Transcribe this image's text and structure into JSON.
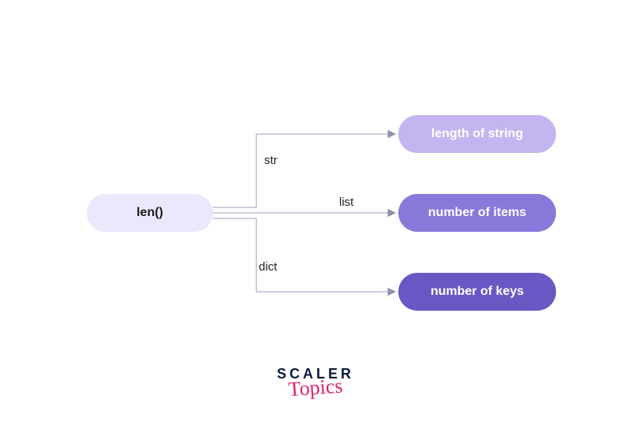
{
  "diagram": {
    "source": {
      "label": "len()"
    },
    "branches": [
      {
        "type_label": "str",
        "output_label": "length of string"
      },
      {
        "type_label": "list",
        "output_label": "number of items"
      },
      {
        "type_label": "dict",
        "output_label": "number of keys"
      }
    ]
  },
  "footer": {
    "brand_upper": "SCALER",
    "brand_lower": "Topics"
  },
  "colors": {
    "source_bg": "#ece7fb",
    "out1_bg": "#c4b5f0",
    "out2_bg": "#8a78db",
    "out3_bg": "#6b57c4",
    "wire": "#b9c1d4",
    "arrow": "#8a92a8"
  }
}
